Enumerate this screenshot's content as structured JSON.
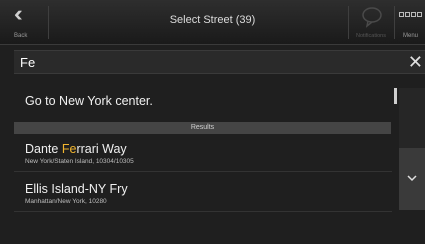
{
  "header": {
    "back_label": "Back",
    "title": "Select Street (39)",
    "bubble_label": "Notifications",
    "menu_label": "Menu"
  },
  "search": {
    "value": "Fe"
  },
  "list": {
    "goto": "Go to New York center.",
    "results_header": "Results",
    "items": [
      {
        "name_pre": "Dante ",
        "name_hl": "Fe",
        "name_post": "rrari Way",
        "sub": "New York/Staten Island, 10304/10305"
      },
      {
        "name_pre": "Ellis Island-NY Fry",
        "name_hl": "",
        "name_post": "",
        "sub": "Manhattan/New York, 10280"
      }
    ]
  },
  "colors": {
    "highlight": "#f2b52e",
    "background": "#1f1f1f"
  }
}
